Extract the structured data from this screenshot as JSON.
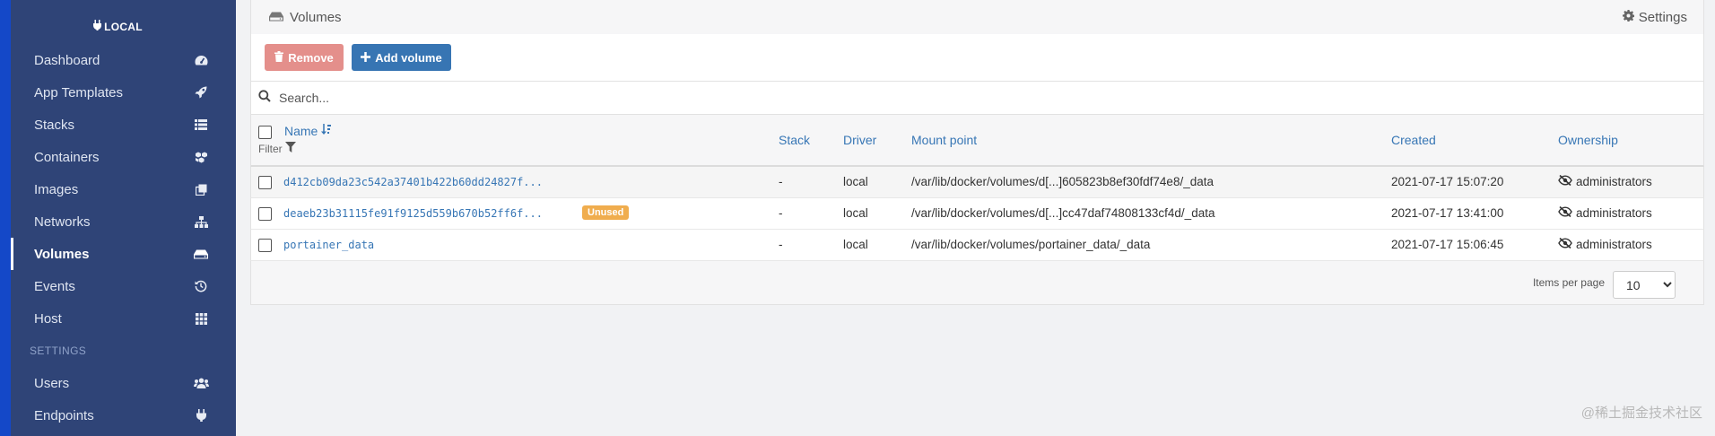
{
  "sidebar": {
    "environment": "LOCAL",
    "items": [
      {
        "label": "Dashboard",
        "icon": "tachometer-icon"
      },
      {
        "label": "App Templates",
        "icon": "rocket-icon"
      },
      {
        "label": "Stacks",
        "icon": "list-icon"
      },
      {
        "label": "Containers",
        "icon": "cubes-icon"
      },
      {
        "label": "Images",
        "icon": "clone-icon"
      },
      {
        "label": "Networks",
        "icon": "sitemap-icon"
      },
      {
        "label": "Volumes",
        "icon": "hdd-icon",
        "active": true
      },
      {
        "label": "Events",
        "icon": "history-icon"
      },
      {
        "label": "Host",
        "icon": "th-icon"
      }
    ],
    "settings_title": "SETTINGS",
    "settings_items": [
      {
        "label": "Users",
        "icon": "users-icon"
      },
      {
        "label": "Endpoints",
        "icon": "plug-icon"
      }
    ]
  },
  "panel": {
    "title": "Volumes",
    "settings_label": "Settings"
  },
  "toolbar": {
    "remove_label": "Remove",
    "add_label": "Add volume"
  },
  "search": {
    "placeholder": "Search..."
  },
  "table": {
    "headers": {
      "name": "Name",
      "filter": "Filter",
      "stack": "Stack",
      "driver": "Driver",
      "mount_point": "Mount point",
      "created": "Created",
      "ownership": "Ownership"
    },
    "rows": [
      {
        "name": "d412cb09da23c542a37401b422b60dd24827f...",
        "badge": "",
        "stack": "-",
        "driver": "local",
        "mount_point": "/var/lib/docker/volumes/d[...]605823b8ef30fdf74e8/_data",
        "created": "2021-07-17 15:07:20",
        "ownership": "administrators"
      },
      {
        "name": "deaeb23b31115fe91f9125d559b670b52ff6f...",
        "badge": "Unused",
        "stack": "-",
        "driver": "local",
        "mount_point": "/var/lib/docker/volumes/d[...]cc47daf74808133cf4d/_data",
        "created": "2021-07-17 13:41:00",
        "ownership": "administrators"
      },
      {
        "name": "portainer_data",
        "badge": "",
        "stack": "-",
        "driver": "local",
        "mount_point": "/var/lib/docker/volumes/portainer_data/_data",
        "created": "2021-07-17 15:06:45",
        "ownership": "administrators"
      }
    ]
  },
  "pagination": {
    "items_per_page_label": "Items per page",
    "items_per_page_value": "10"
  },
  "watermark": "@稀土掘金技术社区",
  "colors": {
    "sidebar_bg": "#2f4477",
    "sidebar_edge": "#1448c8",
    "link": "#3776b5",
    "remove_button": "#e48f8b",
    "add_button": "#3775b3",
    "unused_badge": "#f0ad4e"
  }
}
